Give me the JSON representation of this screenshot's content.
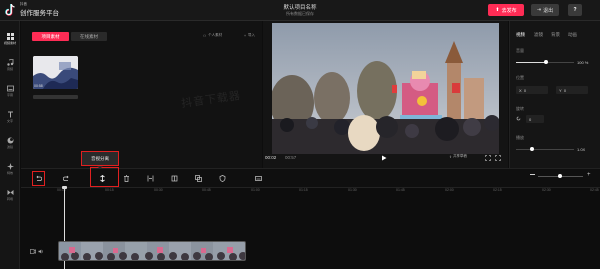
{
  "app": {
    "brand_small": "抖音",
    "brand": "创作服务平台",
    "project_title": "默认项目名称",
    "project_subtitle": "所有数据已保存"
  },
  "header": {
    "publish_label": "去发布",
    "exit_label": "退出",
    "help_label": "?"
  },
  "nav": [
    {
      "label": "视频素材",
      "icon": "grid-icon"
    },
    {
      "label": "音频",
      "icon": "music-icon"
    },
    {
      "label": "字幕",
      "icon": "subtitle-icon"
    },
    {
      "label": "文字",
      "icon": "text-icon"
    },
    {
      "label": "滤镜",
      "icon": "filter-icon"
    },
    {
      "label": "特效",
      "icon": "effects-icon"
    },
    {
      "label": "转场",
      "icon": "transition-icon"
    }
  ],
  "media": {
    "tab_project": "项目素材",
    "tab_online": "在线素材",
    "personal_label": "个人素材",
    "import_label": "导入",
    "thumb_duration": "00:58",
    "watermark": "抖音下载器"
  },
  "preview": {
    "current_time": "00:02",
    "total_time": "00:57",
    "share_label": "共享草稿"
  },
  "props": {
    "tabs": [
      "视频",
      "滤镜",
      "背景",
      "动画"
    ],
    "volume_label": "音量",
    "volume_value": "100 %",
    "position_label": "位置",
    "x_label": "X",
    "x_value": "0",
    "y_label": "Y",
    "y_value": "0",
    "rotate_label": "旋转",
    "rotate_value": "0",
    "speed_label": "播放",
    "speed_value": "1.0X"
  },
  "toolbar": {
    "tooltip": "音视分离"
  },
  "timeline": {
    "ticks": [
      "00:00",
      "00:15",
      "00:30",
      "00:45",
      "01:00",
      "01:15",
      "01:30",
      "01:45",
      "02:00",
      "02:15",
      "02:30",
      "02:45"
    ]
  }
}
